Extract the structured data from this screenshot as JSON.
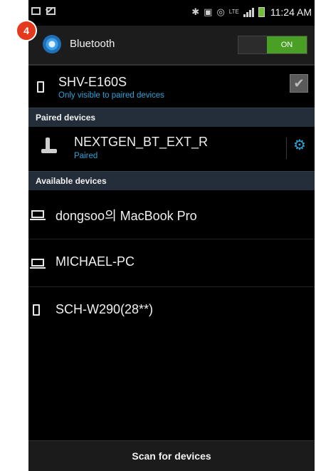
{
  "step_badge": "4",
  "status_bar": {
    "time": "11:24 AM",
    "network": "LTE"
  },
  "action_bar": {
    "title": "Bluetooth",
    "toggle_label": "ON"
  },
  "my_device": {
    "name": "SHV-E160S",
    "subtitle": "Only visible to paired devices"
  },
  "paired_section": {
    "header": "Paired devices",
    "devices": [
      {
        "name": "NEXTGEN_BT_EXT_R",
        "status": "Paired",
        "icon": "headset-icon"
      }
    ]
  },
  "available_section": {
    "header": "Available devices",
    "devices": [
      {
        "name": "dongsoo의 MacBook Pro",
        "icon": "laptop-icon"
      },
      {
        "name": "MICHAEL-PC",
        "icon": "laptop-icon"
      },
      {
        "name": "SCH-W290(28**)",
        "icon": "phone-icon"
      }
    ]
  },
  "footer": {
    "scan_label": "Scan for devices"
  },
  "colors": {
    "accent": "#2ea3d8",
    "toggle_on": "#4aa024",
    "section_header": "#242d3a",
    "badge": "#e5391e"
  }
}
